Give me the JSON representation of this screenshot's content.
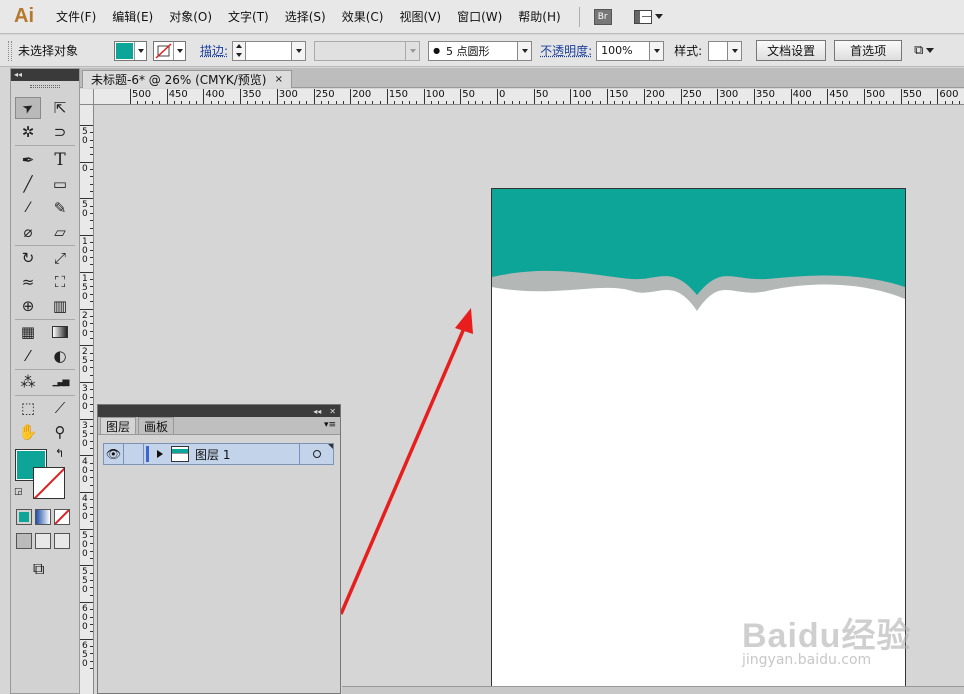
{
  "menubar": {
    "logo": "Ai",
    "items": [
      {
        "label": "文件(F)"
      },
      {
        "label": "编辑(E)"
      },
      {
        "label": "对象(O)"
      },
      {
        "label": "文字(T)"
      },
      {
        "label": "选择(S)"
      },
      {
        "label": "效果(C)"
      },
      {
        "label": "视图(V)"
      },
      {
        "label": "窗口(W)"
      },
      {
        "label": "帮助(H)"
      }
    ],
    "bridge_label": "Br"
  },
  "controlbar": {
    "selection_status": "未选择对象",
    "fill_color": "#0ca598",
    "stroke_label": "描边:",
    "stroke_weight": "",
    "brush_label": "5 点圆形",
    "opacity_label": "不透明度:",
    "opacity_value": "100%",
    "style_label": "样式:",
    "doc_setup_button": "文档设置",
    "preferences_button": "首选项"
  },
  "document": {
    "tab_title": "未标题-6* @ 26% (CMYK/预览)",
    "close_glyph": "×"
  },
  "ruler": {
    "h_labels": [
      "500",
      "450",
      "400",
      "350",
      "300",
      "250",
      "200",
      "150",
      "100",
      "50",
      "0",
      "50",
      "100",
      "150",
      "200",
      "250",
      "300",
      "350",
      "400",
      "450",
      "500",
      "550",
      "600"
    ],
    "v_labels": [
      "50",
      "0",
      "50",
      "100",
      "150",
      "200",
      "250",
      "300",
      "350",
      "400",
      "450",
      "500",
      "550",
      "600",
      "650"
    ]
  },
  "toolbox": {
    "header": "◂◂",
    "tools": [
      {
        "name": "selection-tool",
        "glyph": "➤"
      },
      {
        "name": "direct-selection-tool",
        "glyph": "⇱"
      },
      {
        "name": "magic-wand-tool",
        "glyph": "✲"
      },
      {
        "name": "lasso-tool",
        "glyph": "⊃"
      },
      {
        "name": "pen-tool",
        "glyph": "✒"
      },
      {
        "name": "type-tool",
        "glyph": "T"
      },
      {
        "name": "line-tool",
        "glyph": "╱"
      },
      {
        "name": "rectangle-tool",
        "glyph": "▭"
      },
      {
        "name": "paintbrush-tool",
        "glyph": "🖌"
      },
      {
        "name": "pencil-tool",
        "glyph": "✎"
      },
      {
        "name": "blob-brush-tool",
        "glyph": "⌀"
      },
      {
        "name": "eraser-tool",
        "glyph": "▱"
      },
      {
        "name": "rotate-tool",
        "glyph": "↻"
      },
      {
        "name": "scale-tool",
        "glyph": "⤢"
      },
      {
        "name": "width-tool",
        "glyph": "≈"
      },
      {
        "name": "free-transform-tool",
        "glyph": "⛶"
      },
      {
        "name": "shape-builder-tool",
        "glyph": "⊕"
      },
      {
        "name": "perspective-grid-tool",
        "glyph": "▥"
      },
      {
        "name": "mesh-tool",
        "glyph": "▦"
      },
      {
        "name": "gradient-tool",
        "glyph": "▮"
      },
      {
        "name": "eyedropper-tool",
        "glyph": "⁄"
      },
      {
        "name": "blend-tool",
        "glyph": "◐"
      },
      {
        "name": "symbol-sprayer-tool",
        "glyph": "⁂"
      },
      {
        "name": "column-graph-tool",
        "glyph": "▁▃▅"
      },
      {
        "name": "artboard-tool",
        "glyph": "⬚"
      },
      {
        "name": "slice-tool",
        "glyph": "⟋"
      },
      {
        "name": "hand-tool",
        "glyph": "✋"
      },
      {
        "name": "zoom-tool",
        "glyph": "⚲"
      }
    ],
    "fill_color": "#0ca598",
    "stroke_color": "none"
  },
  "layers_panel": {
    "tabs": [
      {
        "label": "图层",
        "active": true
      },
      {
        "label": "画板",
        "active": false
      }
    ],
    "layers": [
      {
        "name": "图层 1",
        "visible": true
      }
    ]
  },
  "artwork": {
    "top_band_color": "#0ca598",
    "shadow_color": "#b3b7b6",
    "annotation_arrow_color": "#e81e1e"
  },
  "watermark": {
    "brand": "Baidu经验",
    "url": "jingyan.baidu.com"
  }
}
